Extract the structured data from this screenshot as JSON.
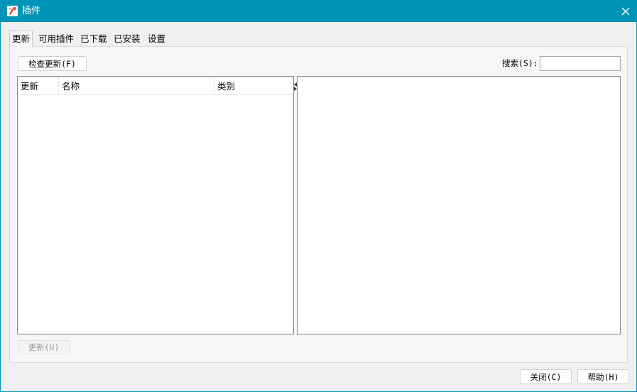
{
  "window": {
    "title": "插件",
    "app_icon": "app-logo-icon",
    "close_icon": "close-icon",
    "accent": "#0095b6"
  },
  "tabs": [
    {
      "label": "更新",
      "active": true
    },
    {
      "label": "可用插件",
      "active": false
    },
    {
      "label": "已下载",
      "active": false
    },
    {
      "label": "已安装",
      "active": false
    },
    {
      "label": "设置",
      "active": false
    }
  ],
  "toolbar": {
    "check_updates_label": "检查更新(F)",
    "search_label": "搜索(S):",
    "search_value": ""
  },
  "table": {
    "columns": [
      "更新",
      "名称",
      "类别"
    ],
    "rows": []
  },
  "panel_footer": {
    "update_label": "更新(U)"
  },
  "footer": {
    "close_label": "关闭(C)",
    "help_label": "帮助(H)"
  }
}
